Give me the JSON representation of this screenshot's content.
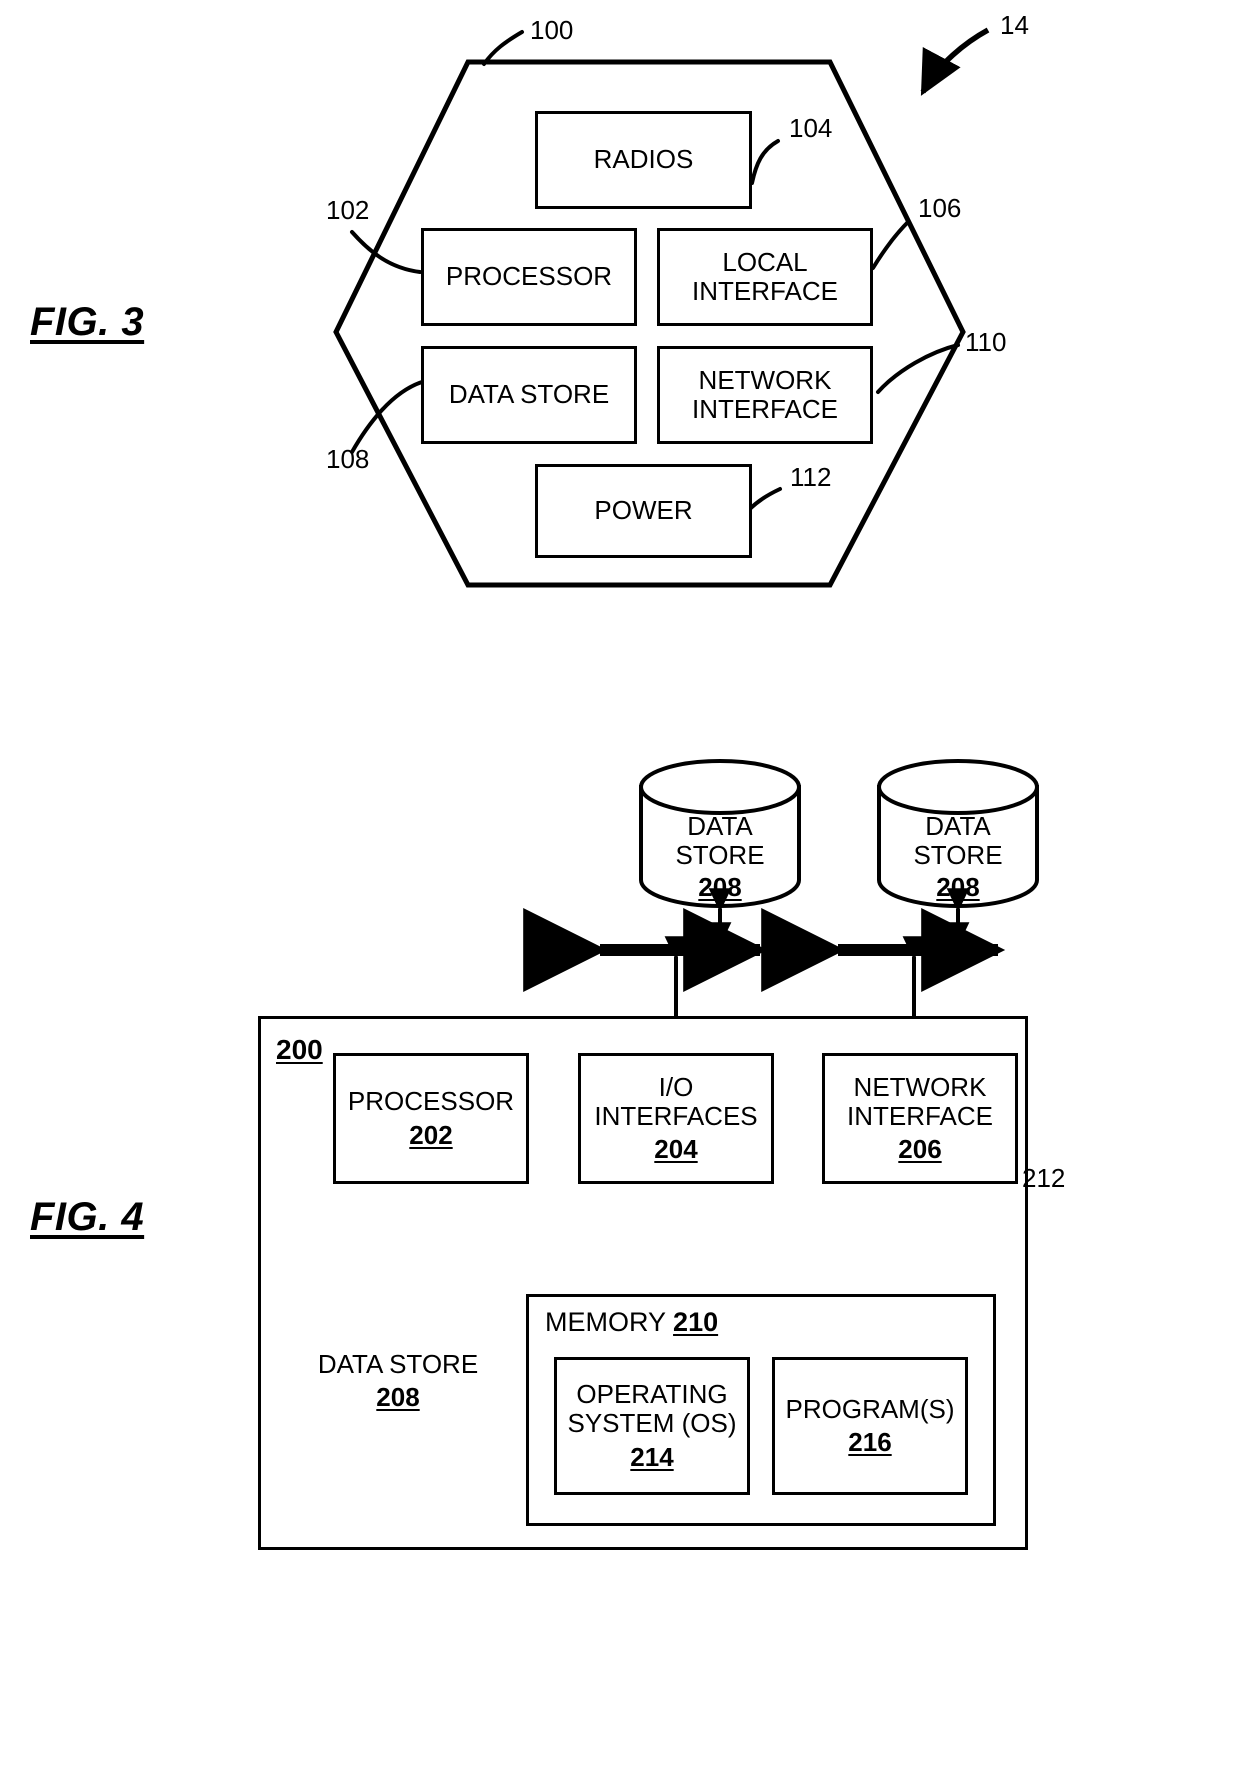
{
  "figures": [
    {
      "id": "fig3",
      "label": "FIG. 3",
      "callout": "14",
      "node_ref": "100",
      "blocks": [
        {
          "ref": "104",
          "lines": [
            "RADIOS"
          ]
        },
        {
          "ref": "102",
          "lines": [
            "PROCESSOR"
          ]
        },
        {
          "ref": "106",
          "lines": [
            "LOCAL",
            "INTERFACE"
          ]
        },
        {
          "ref": "108",
          "lines": [
            "DATA STORE"
          ]
        },
        {
          "ref": "110",
          "lines": [
            "NETWORK",
            "INTERFACE"
          ]
        },
        {
          "ref": "112",
          "lines": [
            "POWER"
          ]
        }
      ]
    },
    {
      "id": "fig4",
      "label": "FIG. 4",
      "server_ref": "200",
      "bus_ref": "212",
      "external_stores": [
        {
          "label": "DATA STORE",
          "ref": "208"
        },
        {
          "label": "DATA STORE",
          "ref": "208"
        }
      ],
      "top_blocks": [
        {
          "lines": [
            "PROCESSOR"
          ],
          "ref": "202"
        },
        {
          "lines": [
            "I/O",
            "INTERFACES"
          ],
          "ref": "204"
        },
        {
          "lines": [
            "NETWORK",
            "INTERFACE"
          ],
          "ref": "206"
        }
      ],
      "internal_store": {
        "label": "DATA STORE",
        "ref": "208"
      },
      "memory": {
        "title": "MEMORY",
        "ref": "210",
        "blocks": [
          {
            "lines": [
              "OPERATING",
              "SYSTEM (OS)"
            ],
            "ref": "214"
          },
          {
            "lines": [
              "PROGRAM(S)"
            ],
            "ref": "216"
          }
        ]
      }
    }
  ],
  "fig3": {
    "label": "FIG. 3",
    "callout": "14",
    "node_ref": "100",
    "radios": {
      "text": "RADIOS",
      "ref": "104"
    },
    "processor": {
      "text": "PROCESSOR",
      "ref": "102"
    },
    "local_interface": {
      "line1": "LOCAL",
      "line2": "INTERFACE",
      "ref": "106"
    },
    "data_store": {
      "text": "DATA STORE",
      "ref": "108"
    },
    "network_interface": {
      "line1": "NETWORK",
      "line2": "INTERFACE",
      "ref": "110"
    },
    "power": {
      "text": "POWER",
      "ref": "112"
    }
  },
  "fig4": {
    "label": "FIG. 4",
    "server_ref": "200",
    "bus_ref": "212",
    "store_a": {
      "text": "DATA STORE",
      "ref": "208"
    },
    "store_b": {
      "text": "DATA STORE",
      "ref": "208"
    },
    "store_internal": {
      "text": "DATA STORE",
      "ref": "208"
    },
    "processor": {
      "text": "PROCESSOR",
      "ref": "202"
    },
    "io_interfaces": {
      "line1": "I/O",
      "line2": "INTERFACES",
      "ref": "204"
    },
    "network_interface": {
      "line1": "NETWORK",
      "line2": "INTERFACE",
      "ref": "206"
    },
    "memory": {
      "title": "MEMORY",
      "ref": "210"
    },
    "os": {
      "line1": "OPERATING",
      "line2": "SYSTEM (OS)",
      "ref": "214"
    },
    "programs": {
      "text": "PROGRAM(S)",
      "ref": "216"
    }
  },
  "colors": {
    "ink": "#000000",
    "paper": "#ffffff"
  }
}
